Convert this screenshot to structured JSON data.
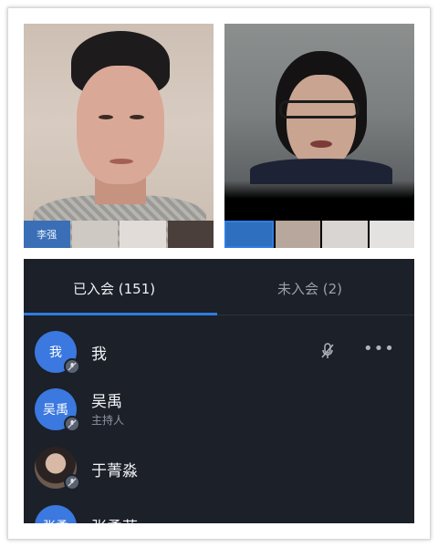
{
  "video": {
    "left_tile_name": "李强"
  },
  "tabs": {
    "joined_label": "已入会 (151)",
    "not_joined_label": "未入会 (2)"
  },
  "participants": [
    {
      "avatar_text": "我",
      "name": "我",
      "role": ""
    },
    {
      "avatar_text": "吴禹",
      "name": "吴禹",
      "role": "主持人"
    },
    {
      "avatar_text": "",
      "name": "于菁淼",
      "role": ""
    },
    {
      "avatar_text": "张柔",
      "name": "张柔菲",
      "role": ""
    }
  ],
  "colors": {
    "panel_bg": "#1b2029",
    "accent": "#2f7de1",
    "avatar_blue": "#3b78df"
  },
  "icons": [
    "mic-muted-icon",
    "more-icon"
  ]
}
